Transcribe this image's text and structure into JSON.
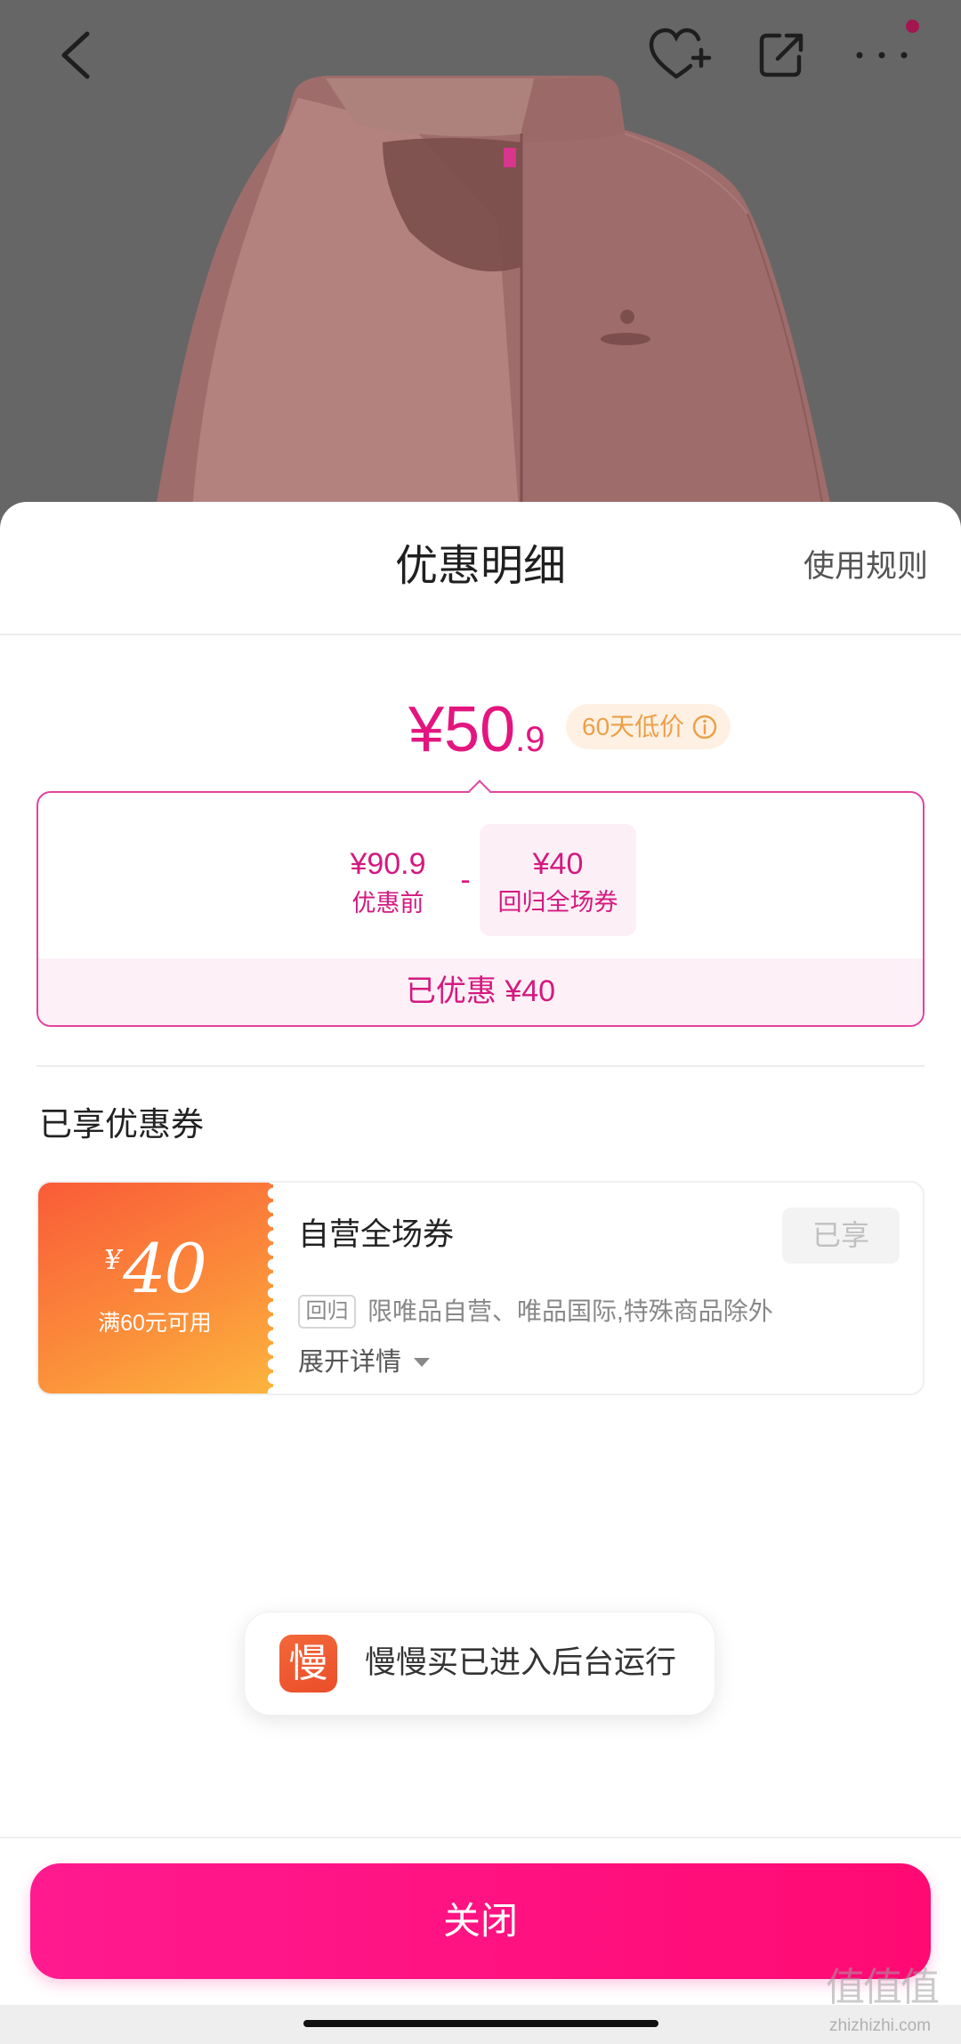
{
  "top_bar": {
    "back_icon": "back-icon",
    "favorite_icon": "heart-plus-icon",
    "share_icon": "share-icon",
    "more_icon": "more-dots-icon"
  },
  "sheet": {
    "title": "优惠明细",
    "rules_link": "使用规则",
    "final_price": {
      "main": "¥50",
      "decimal": ".9"
    },
    "price_badge": {
      "label": "60天低价",
      "icon": "info-icon"
    },
    "breakdown": {
      "original_price": "¥90.9",
      "original_label": "优惠前",
      "operator": "-",
      "discount_amount": "¥40",
      "discount_label": "回归全场券",
      "total_saved": "已优惠 ¥40"
    },
    "coupons_heading": "已享优惠券",
    "coupons": [
      {
        "currency": "¥",
        "amount": "40",
        "condition": "满60元可用",
        "name": "自营全场券",
        "status": "已享",
        "tag": "回归",
        "scope": "限唯品自营、唯品国际,特殊商品除外",
        "expand_label": "展开详情",
        "expand_icon": "caret-down-icon"
      }
    ]
  },
  "toast": {
    "app_icon_glyph": "慢",
    "message": "慢慢买已进入后台运行"
  },
  "close_button": {
    "label": "关闭"
  },
  "watermark": {
    "logo_text": "值值值",
    "domain": "zhizhizhi.com"
  },
  "colors": {
    "accent": "#e3157f",
    "button_start": "#ff1a8f",
    "button_end": "#ff0a73",
    "badge_text": "#eca04a",
    "badge_bg": "#fef1e3",
    "coupon_start": "#fa5b38",
    "coupon_end": "#fcb43e",
    "app_icon": "#ea4e2a",
    "more_badge": "#a3164f"
  }
}
